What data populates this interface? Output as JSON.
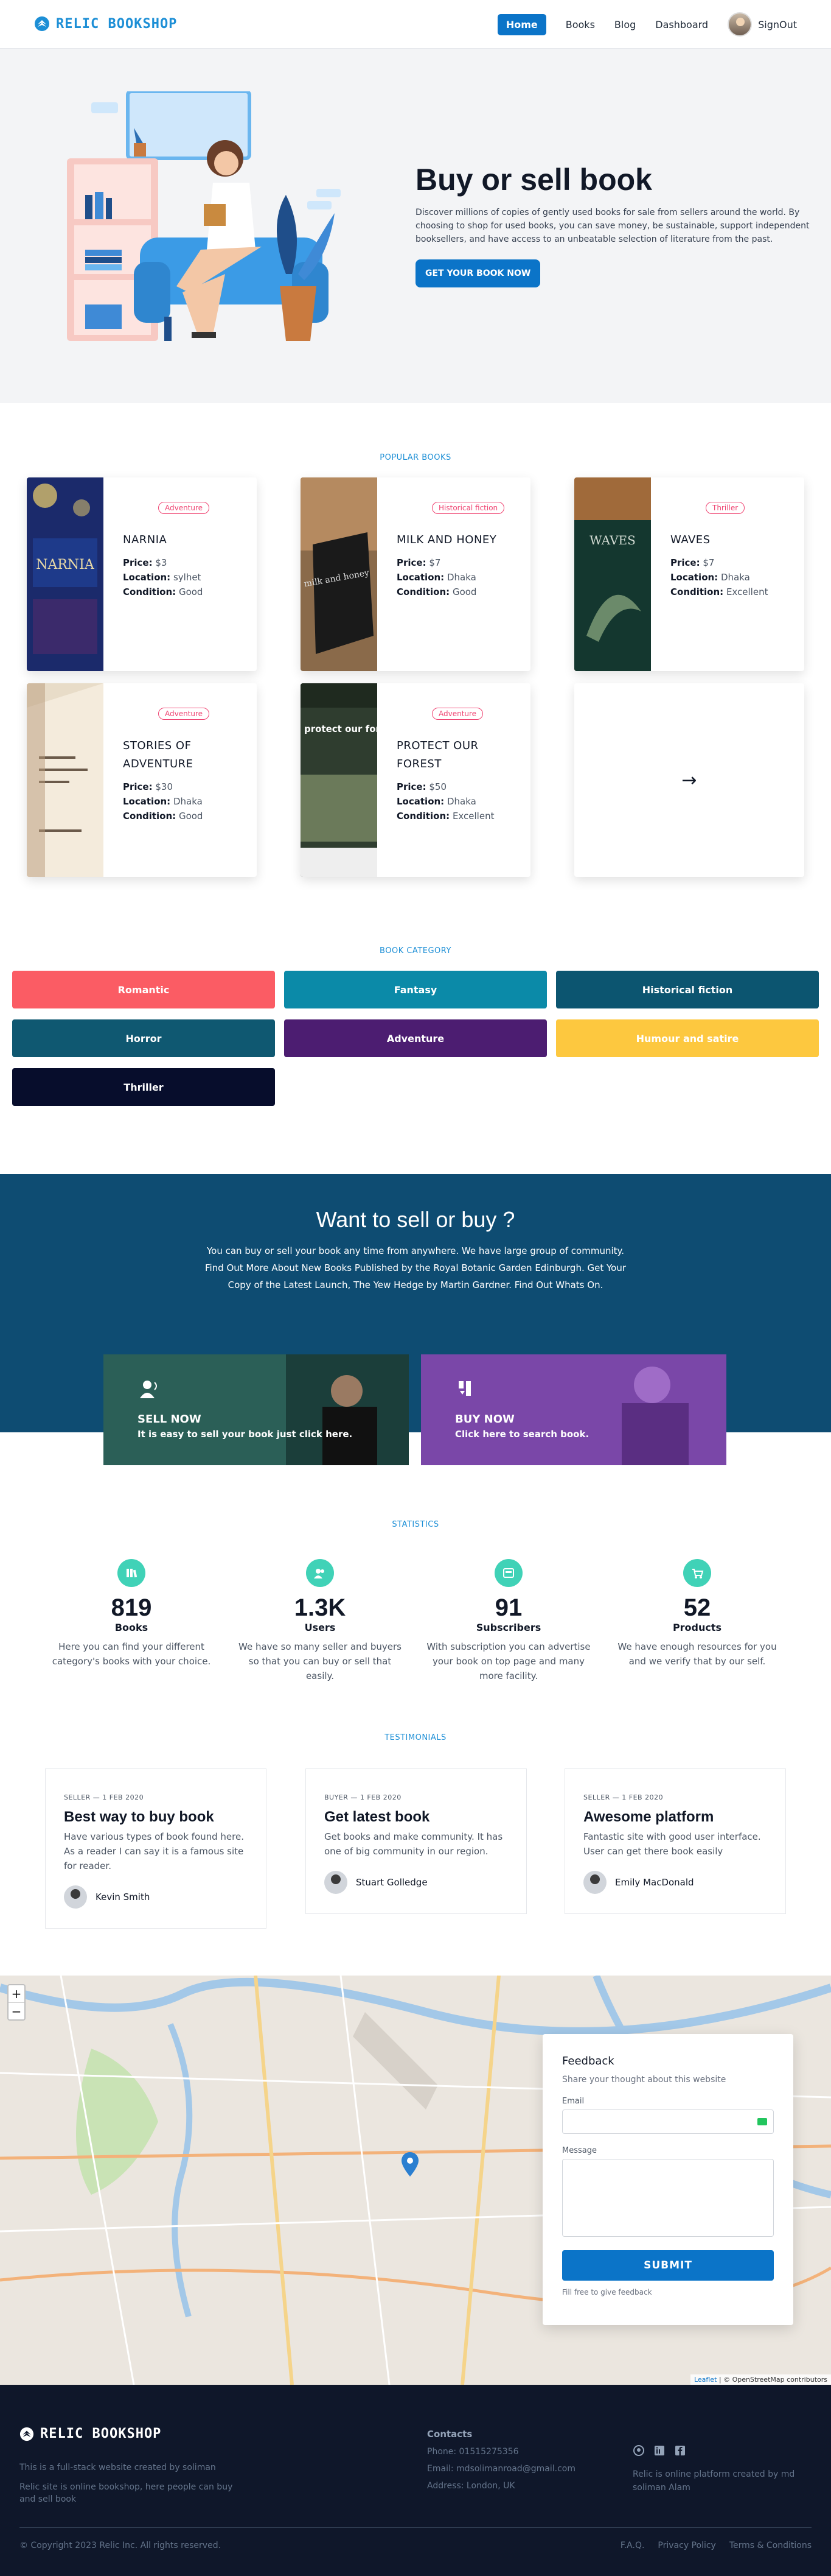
{
  "nav": {
    "brand": "RELIC BOOKSHOP",
    "links": [
      "Home",
      "Books",
      "Blog",
      "Dashboard"
    ],
    "active_link": "Home",
    "signout": "SignOut"
  },
  "hero": {
    "title": "Buy or sell book",
    "text": "Discover millions of copies of gently used books for sale from sellers around the world. By choosing to shop for used books, you can save money, be sustainable, support independent booksellers, and have access to an unbeatable selection of literature from the past.",
    "cta": "GET YOUR BOOK NOW"
  },
  "popular": {
    "label": "POPULAR BOOKS",
    "books": [
      {
        "tag": "Adventure",
        "title": "NARNIA",
        "price": "$3",
        "location": "sylhet",
        "condition": "Good"
      },
      {
        "tag": "Historical fiction",
        "title": "MILK AND HONEY",
        "price": "$7",
        "location": "Dhaka",
        "condition": "Good"
      },
      {
        "tag": "Thriller",
        "title": "WAVES",
        "price": "$7",
        "location": "Dhaka",
        "condition": "Excellent"
      },
      {
        "tag": "Adventure",
        "title": "STORIES OF ADVENTURE",
        "price": "$30",
        "location": "Dhaka",
        "condition": "Good"
      },
      {
        "tag": "Adventure",
        "title": "PROTECT OUR FOREST",
        "price": "$50",
        "location": "Dhaka",
        "condition": "Excellent"
      }
    ],
    "field_labels": {
      "price": "Price:",
      "location": "Location:",
      "condition": "Condition:"
    },
    "cover_text": {
      "narnia": "NARNIA",
      "waves": "WAVES",
      "milk": "milk and honey",
      "forest": "protect our forest"
    }
  },
  "categories": {
    "label": "BOOK CATEGORY",
    "items": [
      {
        "name": "Romantic",
        "color": "#fb5c64"
      },
      {
        "name": "Fantasy",
        "color": "#0b8aa8"
      },
      {
        "name": "Historical fiction",
        "color": "#0c5570"
      },
      {
        "name": "Horror",
        "color": "#0f5871"
      },
      {
        "name": "Adventure",
        "color": "#4c1d71"
      },
      {
        "name": "Humour and satire",
        "color": "#fdc83f"
      },
      {
        "name": "Thriller",
        "color": "#070d2c"
      }
    ]
  },
  "sellbuy": {
    "title": "Want to sell or buy ?",
    "text": "You can buy or sell your book any time from anywhere. We have large group of community. Find Out More About New Books Published by the Royal Botanic Garden Edinburgh. Get Your Copy of the Latest Launch, The Yew Hedge by Martin Gardner. Find Out Whats On.",
    "sell_title": "SELL NOW",
    "sell_sub": "It is easy to sell your book just click here.",
    "buy_title": "BUY NOW",
    "buy_sub": "Click here to search book."
  },
  "stats": {
    "label": "STATISTICS",
    "items": [
      {
        "num": "819",
        "label": "Books",
        "desc": "Here you can find your different category's books with your choice."
      },
      {
        "num": "1.3K",
        "label": "Users",
        "desc": "We have so many seller and buyers so that you can buy or sell that easily."
      },
      {
        "num": "91",
        "label": "Subscribers",
        "desc": "With subscription you can advertise your book on top page and many more facility."
      },
      {
        "num": "52",
        "label": "Products",
        "desc": "We have enough resources for you and we verify that by our self."
      }
    ]
  },
  "testimonials": {
    "label": "TESTIMONIALS",
    "items": [
      {
        "meta": "SELLER — 1 FEB 2020",
        "title": "Best way to buy book",
        "text": "Have various types of book found here. As a reader I can say it is a famous site for reader.",
        "user": "Kevin Smith"
      },
      {
        "meta": "BUYER — 1 FEB 2020",
        "title": "Get latest book",
        "text": "Get books and make community. It has one of big community in our region.",
        "user": "Stuart Golledge"
      },
      {
        "meta": "SELLER — 1 FEB 2020",
        "title": "Awesome platform",
        "text": "Fantastic site with good user interface. User can get there book easily",
        "user": "Emily MacDonald"
      }
    ]
  },
  "map": {
    "zoom_in": "+",
    "zoom_out": "−",
    "attribution_leaflet": "Leaflet",
    "attribution_rest": " | © OpenStreetMap contributors"
  },
  "feedback": {
    "title": "Feedback",
    "subtitle": "Share your thought about this website",
    "email_label": "Email",
    "message_label": "Message",
    "submit": "SUBMIT",
    "note": "Fill free to give feedback"
  },
  "footer": {
    "brand": "RELIC BOOKSHOP",
    "text1": "This is a full-stack website created by soliman",
    "text2": "Relic site is online bookshop, here people can buy and sell book",
    "contacts_title": "Contacts",
    "phone": "Phone: 01515275356",
    "email": "Email: mdsolimanroad@gmail.com",
    "address": "Address: London, UK",
    "right_text": "Relic is online platform created by md soliman Alam",
    "copyright": "© Copyright 2023 Relic Inc. All rights reserved.",
    "links": [
      "F.A.Q.",
      "Privacy Policy",
      "Terms & Conditions"
    ]
  }
}
